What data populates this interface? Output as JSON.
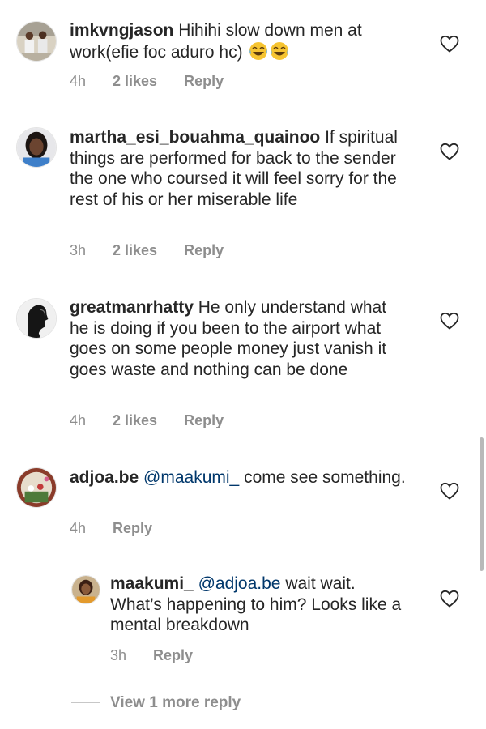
{
  "comments": [
    {
      "username": "imkvngjason",
      "text": "Hihihi slow down men at work(efie foc aduro hc)",
      "emojis": [
        "face-with-tears-of-joy",
        "face-with-tears-of-joy"
      ],
      "time": "4h",
      "likes": "2 likes",
      "reply": "Reply",
      "avatar_icon": "group-photo-avatar"
    },
    {
      "username": "martha_esi_bouahma_quainoo",
      "text": "If spiritual things are performed for back to the sender the one who coursed it will feel sorry for the rest of his or her miserable life",
      "time": "3h",
      "likes": "2 likes",
      "reply": "Reply",
      "avatar_icon": "woman-photo-avatar"
    },
    {
      "username": "greatmanrhatty",
      "text": "He only understand what he is doing if you been to the airport what goes on some people money just vanish it goes waste and nothing can be done",
      "time": "4h",
      "likes": "2 likes",
      "reply": "Reply",
      "avatar_icon": "profile-silhouette-avatar"
    },
    {
      "username": "adjoa.be",
      "mention": "@maakumi_",
      "text": "come see something.",
      "time": "4h",
      "reply": "Reply",
      "avatar_icon": "wedding-photo-avatar"
    }
  ],
  "reply_comment": {
    "username": "maakumi_",
    "mention": "@adjoa.be",
    "text": "wait wait. What’s happening to him? Looks like a mental breakdown",
    "time": "3h",
    "reply": "Reply",
    "avatar_icon": "portrait-photo-avatar"
  },
  "view_more": "View 1 more reply",
  "colors": {
    "text": "#262626",
    "meta": "#8e8e8e",
    "mention": "#00376b",
    "background": "#ffffff"
  }
}
